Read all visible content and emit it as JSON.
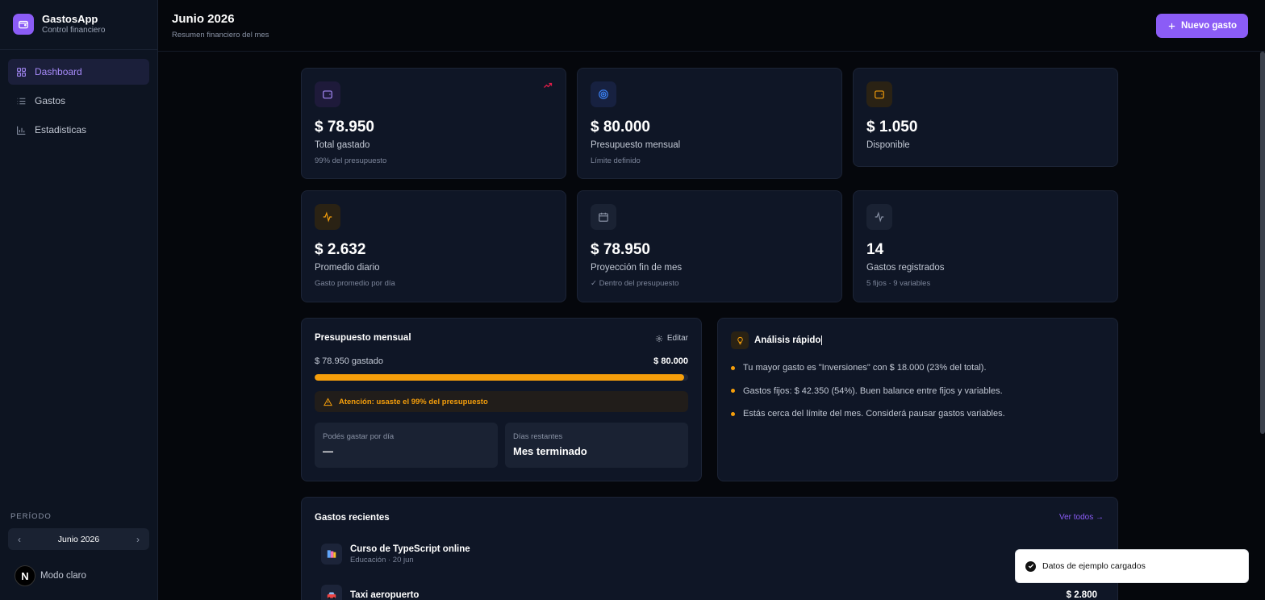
{
  "app": {
    "name": "GastosApp",
    "subtitle": "Control financiero"
  },
  "nav": [
    {
      "label": "Dashboard",
      "icon": "grid-icon",
      "active": true
    },
    {
      "label": "Gastos",
      "icon": "list-icon"
    },
    {
      "label": "Estadisticas",
      "icon": "bar-chart-icon"
    }
  ],
  "period": {
    "label": "PERÍODO",
    "value": "Junio 2026",
    "prev": "‹",
    "next": "›"
  },
  "theme_toggle": {
    "label": "Modo claro",
    "logo_letter": "N"
  },
  "header": {
    "title": "Junio 2026",
    "subtitle": "Resumen financiero del mes",
    "new_button": "Nuevo gasto",
    "new_button_icon": "plus-icon"
  },
  "stats": [
    {
      "value": "$ 78.950",
      "label": "Total gastado",
      "hint": "99% del presupuesto",
      "icon": "wallet-icon",
      "color": "#a78bfa"
    },
    {
      "value": "$ 80.000",
      "label": "Presupuesto mensual",
      "hint": "Límite definido",
      "icon": "target-icon",
      "color": "#3b82f6"
    },
    {
      "value": "$ 1.050",
      "label": "Disponible",
      "hint": "",
      "icon": "wallet-icon",
      "color": "#f59e0b"
    },
    {
      "value": "$ 2.632",
      "label": "Promedio diario",
      "hint": "Gasto promedio por día",
      "icon": "activity-icon",
      "color": "#f59e0b"
    },
    {
      "value": "$ 78.950",
      "label": "Proyección fin de mes",
      "hint": "✓ Dentro del presupuesto",
      "icon": "calendar-icon",
      "color": "#8a93a6"
    },
    {
      "value": "14",
      "label": "Gastos registrados",
      "hint": "5 fijos · 9 variables",
      "icon": "activity-icon",
      "color": "#8a93a6"
    }
  ],
  "budget": {
    "title": "Presupuesto mensual",
    "edit_label": "Editar",
    "spent_label": "$ 78.950 gastado",
    "total_label": "$ 80.000",
    "progress": 0.99,
    "warning": "Atención: usaste el 99% del presupuesto",
    "per_day_label": "Podés gastar por día",
    "per_day_value": "—",
    "days_left_label": "Días restantes",
    "days_left_value": "Mes terminado"
  },
  "analysis": {
    "title": "Análisis rápido",
    "items": [
      "Tu mayor gasto es \"Inversiones\" con $ 18.000 (23% del total).",
      "Gastos fijos: $ 42.350 (54%). Buen balance entre fijos y variables.",
      "Estás cerca del límite del mes. Considerá pausar gastos variables."
    ]
  },
  "recent": {
    "title": "Gastos recientes",
    "see_all": "Ver todos →",
    "items": [
      {
        "name": "Curso de TypeScript online",
        "meta": "Educación · 20 jun",
        "amount": "",
        "icon": "books-icon"
      },
      {
        "name": "Taxi aeropuerto",
        "meta": "",
        "amount": "$ 2.800",
        "icon": "taxi-icon"
      }
    ]
  },
  "toast": {
    "message": "Datos de ejemplo cargados"
  }
}
